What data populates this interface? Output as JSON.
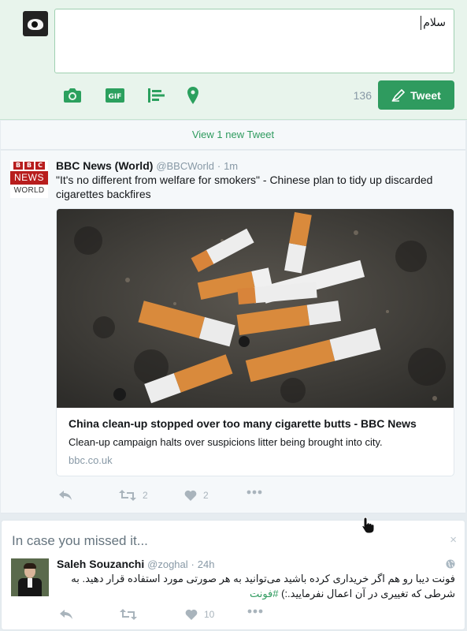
{
  "composer": {
    "text": "سلام",
    "counter": "136",
    "tweet_label": "Tweet",
    "tools": [
      "camera-icon",
      "gif-icon",
      "poll-icon",
      "location-icon"
    ]
  },
  "stream": {
    "new_tweets": "View 1 new Tweet"
  },
  "tweet": {
    "logo": {
      "blocks": [
        "B",
        "B",
        "C"
      ],
      "news": "NEWS",
      "world": "WORLD"
    },
    "name": "BBC News (World)",
    "handle": "@BBCWorld",
    "dot": "·",
    "time": "1m",
    "text": "\"It's no different from welfare for smokers\" - Chinese plan to tidy up discarded cigarettes backfires",
    "card": {
      "title": "China clean-up stopped over too many cigarette butts - BBC News",
      "description": "Clean-up campaign halts over suspicions litter being brought into city.",
      "domain": "bbc.co.uk"
    },
    "retweets": "2",
    "likes": "2"
  },
  "icymi": {
    "title": "In case you missed it...",
    "close": "×",
    "name": "Saleh Souzanchi",
    "handle": "@zoghal",
    "dot": "·",
    "time": "24h",
    "text": "فونت دیبا رو هم اگر خریداری کرده باشید می‌توانید به هر صورتی مورد استفاده قرار دهید. به شرطی که تغییری در آن اعمال نفرمایید.:)",
    "hashtag": "#فونت",
    "likes": "10"
  },
  "colors": {
    "accent": "#2f9b5f",
    "composer_bg": "#e8f4ec",
    "muted": "#8899a6"
  }
}
